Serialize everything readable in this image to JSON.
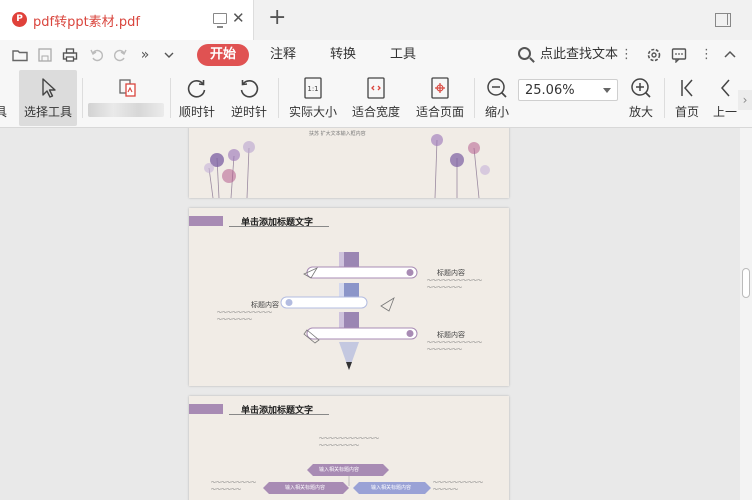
{
  "tab": {
    "title": "pdf转ppt素材.pdf",
    "icon": "pdf-icon"
  },
  "menu": {
    "active": "开始",
    "items": [
      "注释",
      "转换",
      "工具"
    ],
    "search_label": "点此查找文本"
  },
  "toolbar": {
    "partial_left": "具",
    "select_tool": "选择工具",
    "rotate_cw": "顺时针",
    "rotate_ccw": "逆时针",
    "actual_size": "实际大小",
    "fit_width": "适合宽度",
    "fit_page": "适合页面",
    "zoom_out": "缩小",
    "zoom_value": "25.06%",
    "zoom_in": "放大",
    "first_page": "首页",
    "prev_page": "上一"
  },
  "pages": {
    "page1_text": "扶苏 扩大文本输入框内容",
    "page2": {
      "title": "单击添加标题文字",
      "heading_a": "标题内容",
      "heading_b": "标题内容",
      "heading_c": "标题内容"
    },
    "page3": {
      "title": "单击添加标题文字",
      "label_a": "输入相关标题内容",
      "label_b": "输入相关标题内容",
      "label_c": "输入相关标题内容"
    }
  },
  "colors": {
    "accent": "#e05252",
    "purple": "#a88bb4",
    "pdf_red": "#d9453d"
  }
}
